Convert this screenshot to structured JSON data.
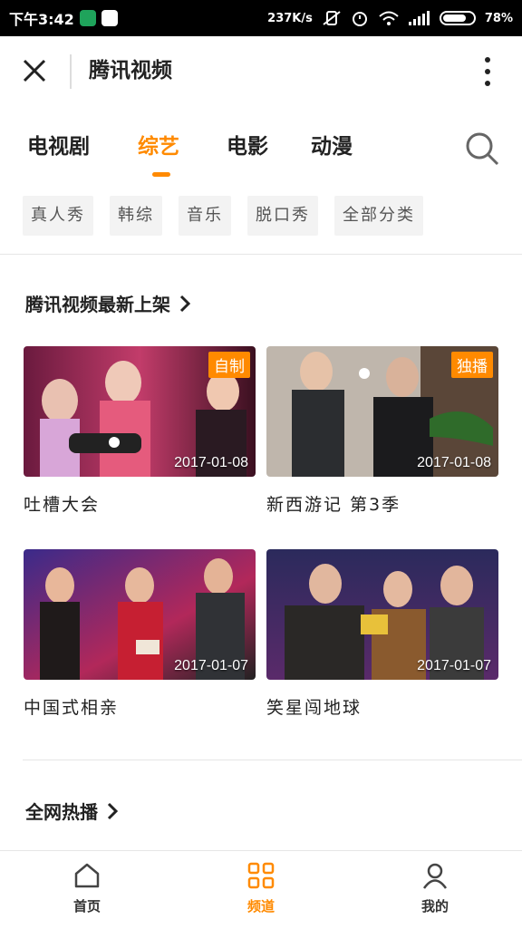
{
  "status_bar": {
    "time": "下午3:42",
    "net_speed": "237K/s",
    "battery": "78%",
    "battery_level": 0.78
  },
  "header": {
    "title": "腾讯视频",
    "close_icon": "close-icon",
    "more_icon": "more-vertical-icon"
  },
  "tabs": [
    {
      "label": "电视剧",
      "active": false
    },
    {
      "label": "综艺",
      "active": true
    },
    {
      "label": "电影",
      "active": false
    },
    {
      "label": "动漫",
      "active": false
    }
  ],
  "search_icon": "search-icon",
  "chips": [
    "真人秀",
    "韩综",
    "音乐",
    "脱口秀",
    "全部分类"
  ],
  "section1": {
    "title": "腾讯视频最新上架",
    "cards": [
      {
        "title": "吐槽大会",
        "date": "2017-01-08",
        "tag": "自制"
      },
      {
        "title": "新西游记 第3季",
        "date": "2017-01-08",
        "tag": "独播"
      },
      {
        "title": "中国式相亲",
        "date": "2017-01-07",
        "tag": ""
      },
      {
        "title": "笑星闯地球",
        "date": "2017-01-07",
        "tag": ""
      }
    ]
  },
  "section2": {
    "title": "全网热播"
  },
  "bottom_nav": [
    {
      "label": "首页",
      "icon": "home-icon",
      "active": false
    },
    {
      "label": "频道",
      "icon": "grid-icon",
      "active": true
    },
    {
      "label": "我的",
      "icon": "user-icon",
      "active": false
    }
  ],
  "colors": {
    "accent": "#ff8a00",
    "chip_bg": "#f3f3f3"
  }
}
